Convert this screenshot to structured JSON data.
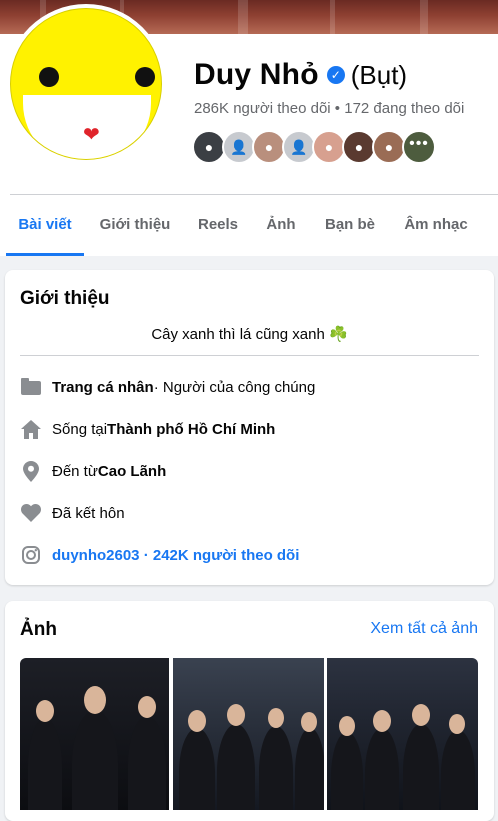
{
  "profile": {
    "name": "Duy Nhỏ",
    "alt_name": "(Bụt)",
    "verified_icon": "verified-badge-icon",
    "followers_line": "286K người theo dõi • 172 đang theo dõi",
    "avatar_icon": "smiley-face-avatar"
  },
  "friends_more_label": "•••",
  "tabs": [
    {
      "label": "Bài viết",
      "active": true
    },
    {
      "label": "Giới thiệu"
    },
    {
      "label": "Reels"
    },
    {
      "label": "Ảnh"
    },
    {
      "label": "Bạn bè"
    },
    {
      "label": "Âm nhạc"
    }
  ],
  "intro": {
    "title": "Giới thiệu",
    "bio": "Cây xanh thì lá cũng xanh",
    "bio_emoji": "☘️",
    "rows": [
      {
        "icon": "page-flag-icon",
        "bold": "Trang cá nhân",
        "text": " · Người của công chúng"
      },
      {
        "icon": "home-icon",
        "text": "Sống tại ",
        "bold": "Thành phố Hồ Chí Minh"
      },
      {
        "icon": "location-pin-icon",
        "text": "Đến từ ",
        "bold": "Cao Lãnh"
      },
      {
        "icon": "heart-icon",
        "text": "Đã kết hôn"
      },
      {
        "icon": "instagram-icon",
        "link": "duynho2603 · 242K người theo dõi"
      }
    ]
  },
  "photos": {
    "title": "Ảnh",
    "see_all": "Xem tất cả ảnh"
  },
  "colors": {
    "accent": "#1877f2",
    "secondary_text": "#65676b",
    "background": "#f0f2f5"
  }
}
